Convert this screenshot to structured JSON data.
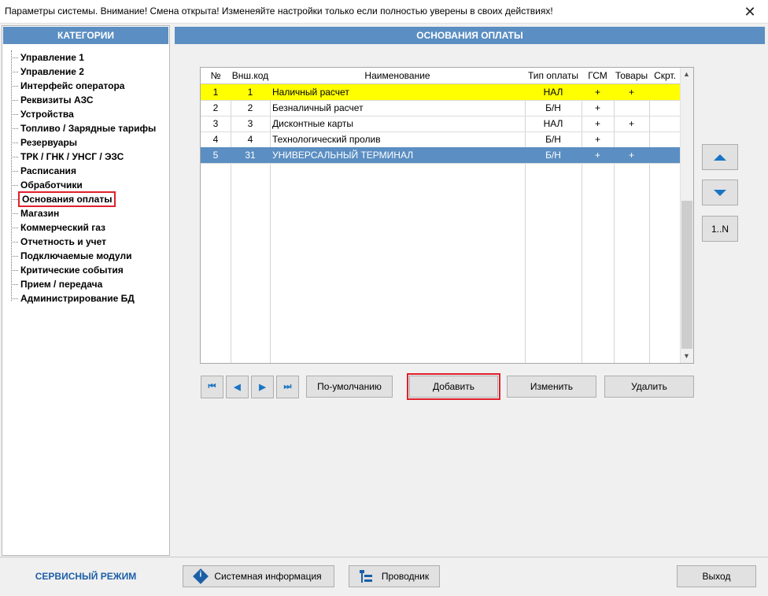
{
  "window": {
    "title": "Параметры системы.   Внимание! Смена открыта! Изменеяйте настройки только если полностью уверены в своих действиях!",
    "close_glyph": "✕"
  },
  "categories": {
    "header": "КАТЕГОРИИ",
    "items": [
      "Управление 1",
      "Управление 2",
      "Интерфейс оператора",
      "Реквизиты АЗС",
      "Устройства",
      "Топливо / Зарядные тарифы",
      "Резервуары",
      "ТРК / ГНК / УНСГ / ЭЗС",
      "Расписания",
      "Обработчики",
      "Основания оплаты",
      "Магазин",
      "Коммерческий газ",
      "Отчетность и учет",
      "Подключаемые модули",
      "Критические события",
      "Прием / передача",
      "Администрирование БД"
    ],
    "selected": "Основания оплаты"
  },
  "section": {
    "header": "ОСНОВАНИЯ ОПЛАТЫ"
  },
  "table": {
    "columns": [
      "№",
      "Внш.код",
      "Наименование",
      "Тип оплаты",
      "ГСМ",
      "Товары",
      "Скрт."
    ],
    "rows": [
      [
        "1",
        "1",
        "Наличный расчет",
        "НАЛ",
        "+",
        "+",
        ""
      ],
      [
        "2",
        "2",
        "Безналичный расчет",
        "Б/Н",
        "+",
        "",
        ""
      ],
      [
        "3",
        "3",
        "Дисконтные карты",
        "НАЛ",
        "+",
        "+",
        ""
      ],
      [
        "4",
        "4",
        "Технологический пролив",
        "Б/Н",
        "+",
        "",
        ""
      ],
      [
        "5",
        "31",
        "УНИВЕРСАЛЬНЫЙ ТЕРМИНАЛ",
        "Б/Н",
        "+",
        "+",
        ""
      ]
    ],
    "highlighted_row": 1,
    "selected_row": 5
  },
  "side_buttons": {
    "up_icon": "arrow-up-icon",
    "down_icon": "arrow-down-icon",
    "renumber_label": "1..N"
  },
  "nav": {
    "first": "⏮",
    "prev": "◀",
    "next": "▶",
    "last": "⏭"
  },
  "actions": {
    "default_label": "По-умолчанию",
    "add_label": "Добавить",
    "edit_label": "Изменить",
    "delete_label": "Удалить"
  },
  "footer": {
    "mode_label": "СЕРВИСНЫЙ РЕЖИМ",
    "sysinfo_label": "Системная информация",
    "explorer_label": "Проводник",
    "exit_label": "Выход"
  },
  "colors": {
    "header_blue": "#5b8ec2",
    "highlight_yellow": "#ffff00",
    "selection_red": "#e0202c",
    "accent_blue": "#1a75c4"
  }
}
